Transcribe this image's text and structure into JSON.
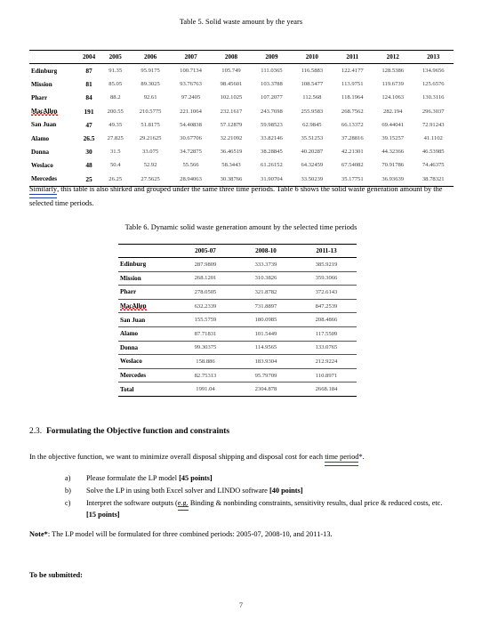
{
  "document": {
    "page_number": "7"
  },
  "table5": {
    "caption": "Table 5. Solid waste amount by the years",
    "columns": [
      "",
      "2004",
      "2005",
      "2006",
      "2007",
      "2008",
      "2009",
      "2010",
      "2011",
      "2012",
      "2013"
    ],
    "rows": [
      {
        "city": "Edinburg",
        "misspelled": false,
        "values": [
          "87",
          "91.35",
          "95.9175",
          "100.7134",
          "105.749",
          "111.0365",
          "116.5883",
          "122.4177",
          "128.5386",
          "134.9656"
        ]
      },
      {
        "city": "Mission",
        "misspelled": false,
        "values": [
          "81",
          "85.05",
          "89.3025",
          "93.76763",
          "98.45601",
          "103.3788",
          "108.5477",
          "113.9751",
          "119.6739",
          "125.6576"
        ]
      },
      {
        "city": "Pharr",
        "misspelled": false,
        "values": [
          "84",
          "88.2",
          "92.61",
          "97.2405",
          "102.1025",
          "107.2077",
          "112.568",
          "118.1964",
          "124.1063",
          "130.3116"
        ]
      },
      {
        "city": "MacAllen",
        "misspelled": true,
        "values": [
          "191",
          "200.55",
          "210.5775",
          "221.1064",
          "232.1617",
          "243.7698",
          "255.9583",
          "268.7562",
          "282.194",
          "296.3037"
        ]
      },
      {
        "city": "San Juan",
        "misspelled": false,
        "values": [
          "47",
          "49.35",
          "51.8175",
          "54.40838",
          "57.12879",
          "59.98523",
          "62.9845",
          "66.13372",
          "69.44041",
          "72.91243"
        ]
      },
      {
        "city": "Alamo",
        "misspelled": false,
        "values": [
          "26.5",
          "27.825",
          "29.21625",
          "30.67706",
          "32.21092",
          "33.82146",
          "35.51253",
          "37.28816",
          "39.15257",
          "41.1102"
        ]
      },
      {
        "city": "Donna",
        "misspelled": false,
        "values": [
          "30",
          "31.5",
          "33.075",
          "34.72875",
          "36.46519",
          "38.28845",
          "40.20287",
          "42.21301",
          "44.32366",
          "46.53985"
        ]
      },
      {
        "city": "Weslaco",
        "misspelled": false,
        "values": [
          "48",
          "50.4",
          "52.92",
          "55.566",
          "58.3443",
          "61.26152",
          "64.32459",
          "67.54082",
          "70.91786",
          "74.46375"
        ]
      },
      {
        "city": "Mercedes",
        "misspelled": false,
        "values": [
          "25",
          "26.25",
          "27.5625",
          "28.94063",
          "30.38766",
          "31.90704",
          "33.50239",
          "35.17751",
          "36.93639",
          "38.78321"
        ]
      }
    ]
  },
  "paragraph1": {
    "grammar_word": "Similarly",
    "rest": ", this table is also shirked and grouped under the same three time periods. Table 6 shows the solid waste generation amount by the selected time periods."
  },
  "table6": {
    "caption": "Table 6. Dynamic solid waste generation amount by the selected time periods",
    "columns": [
      "",
      "2005-07",
      "2008-10",
      "2011-13"
    ],
    "rows": [
      {
        "city": "Edinburg",
        "misspelled": false,
        "values": [
          "287.9809",
          "333.3739",
          "385.9219"
        ]
      },
      {
        "city": "Mission",
        "misspelled": false,
        "values": [
          "268.1201",
          "310.3826",
          "359.3066"
        ]
      },
      {
        "city": "Pharr",
        "misspelled": false,
        "values": [
          "278.0505",
          "321.8782",
          "372.6143"
        ]
      },
      {
        "city": "MacAllen",
        "misspelled": true,
        "values": [
          "632.2339",
          "731.8897",
          "847.2539"
        ]
      },
      {
        "city": "San Juan",
        "misspelled": false,
        "values": [
          "155.5759",
          "180.0985",
          "208.4866"
        ]
      },
      {
        "city": "Alamo",
        "misspelled": false,
        "values": [
          "87.71831",
          "101.5449",
          "117.5509"
        ]
      },
      {
        "city": "Donna",
        "misspelled": false,
        "values": [
          "99.30375",
          "114.9565",
          "133.0765"
        ]
      },
      {
        "city": "Weslaco",
        "misspelled": false,
        "values": [
          "158.886",
          "183.9304",
          "212.9224"
        ]
      },
      {
        "city": "Mercedes",
        "misspelled": false,
        "values": [
          "82.75313",
          "95.79709",
          "110.8971"
        ]
      },
      {
        "city": "Total",
        "misspelled": false,
        "values": [
          "1991.04",
          "2304.878",
          "2668.184"
        ]
      }
    ]
  },
  "section": {
    "number": "2.3.",
    "title": "Formulating the Objective function and constraints",
    "intro_before": "In the objective function, we want to minimize overall disposal shipping and disposal cost for each ",
    "intro_grammar": "time period",
    "intro_after": "*.",
    "items": [
      {
        "label": "a)",
        "text_before": "Please formulate the LP model ",
        "bold": "[45 points]",
        "text_after": ""
      },
      {
        "label": "b)",
        "text_before": "Solve the LP in using both Excel solver and LINDO software ",
        "bold": "[40 points]",
        "text_after": ""
      },
      {
        "label": "c)",
        "text_before": "Interpret the software outputs (",
        "grammar": "e.g.",
        "text_mid": " Binding & nonbinding constraints, sensitivity results, dual price & reduced costs, etc. ",
        "bold": "[15 points]",
        "text_after": ""
      }
    ],
    "note_label": "Note*",
    "note_text": ": The LP model will be formulated for three combined periods: 2005-07, 2008-10, and 2011-13.",
    "to_be_submitted": "To be submitted:"
  }
}
